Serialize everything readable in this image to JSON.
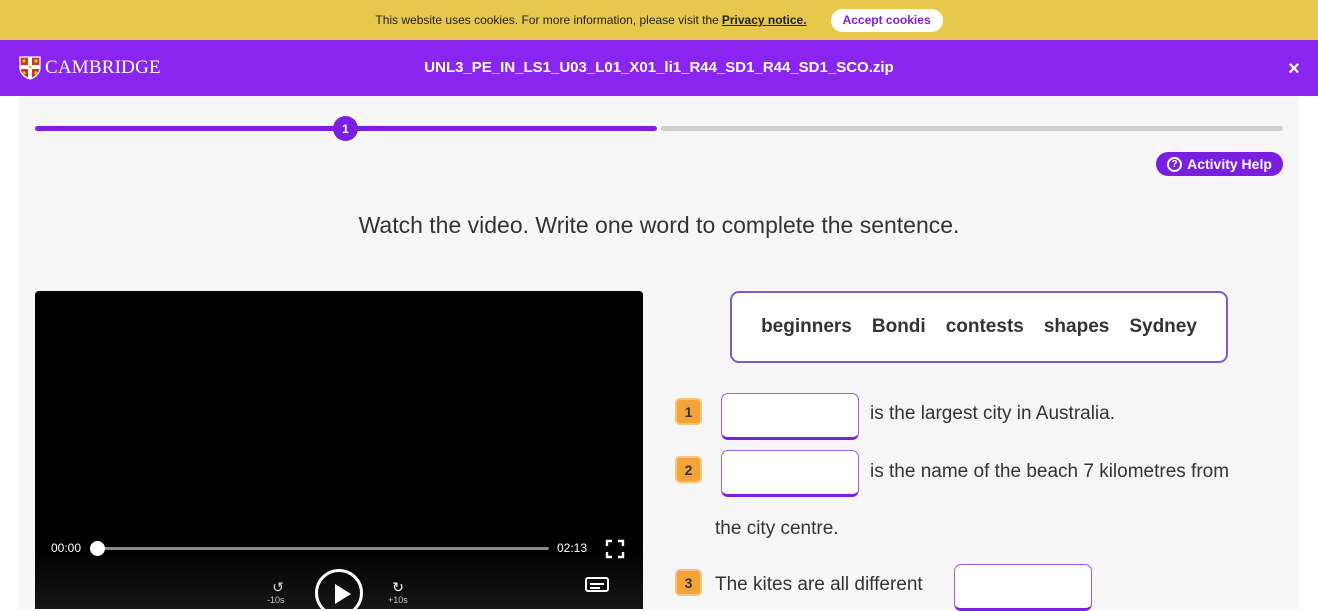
{
  "cookie_bar": {
    "message": "This website uses cookies. For more information, please visit the",
    "privacy_link": "Privacy notice.",
    "accept_label": "Accept cookies"
  },
  "header": {
    "logo_text": "CAMBRIDGE",
    "file_name": "UNL3_PE_IN_LS1_U03_L01_X01_li1_R44_SD1_R44_SD1_SCO.zip",
    "close_label": "×"
  },
  "progress": {
    "current_step": "1",
    "fraction_complete": 0.5
  },
  "help": {
    "icon_glyph": "?",
    "label": "Activity Help"
  },
  "instruction": "Watch the video. Write one word to complete the sentence.",
  "video": {
    "current_time": "00:00",
    "duration": "02:13",
    "rewind_label": "-10s",
    "forward_label": "+10s"
  },
  "word_bank": [
    "beginners",
    "Bondi",
    "contests",
    "shapes",
    "Sydney"
  ],
  "questions": [
    {
      "number": "1",
      "answer": "",
      "text_after": "is the largest city in Australia."
    },
    {
      "number": "2",
      "answer": "",
      "text_after": "is the name of the beach 7 kilometres from",
      "text_continued": "the city centre."
    },
    {
      "number": "3",
      "text_before": "The kites are all different",
      "answer": ""
    }
  ],
  "colors": {
    "cookie_bar": "#e5c84c",
    "brand_purple": "#8a25f0",
    "accent_purple": "#7a1fe0",
    "question_badge": "#f2a33a"
  }
}
